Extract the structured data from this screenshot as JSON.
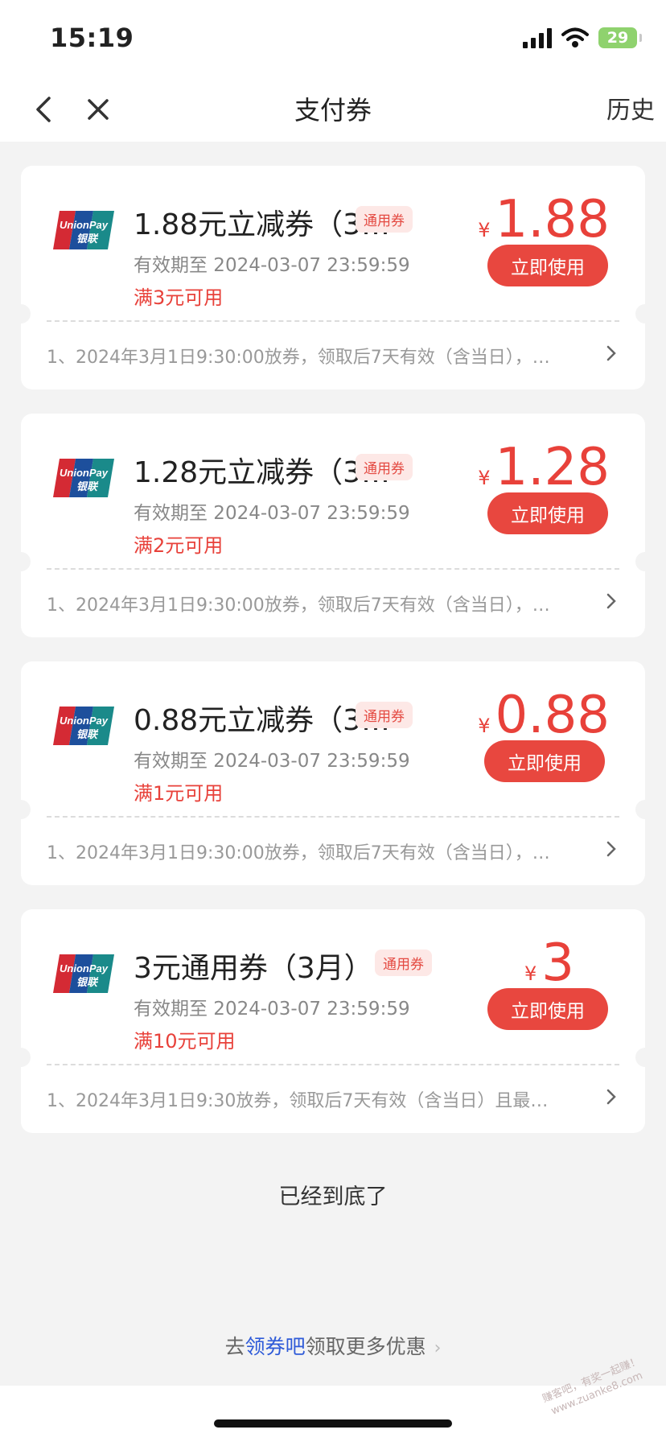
{
  "status_bar": {
    "time": "15:19",
    "battery": "29"
  },
  "header": {
    "title": "支付券",
    "history": "历史"
  },
  "coupons": [
    {
      "title": "1.88元立减券（3…",
      "tag": "通用券",
      "validity": "有效期至 2024-03-07 23:59:59",
      "condition": "满3元可用",
      "currency": "¥",
      "amount": "1.88",
      "button": "立即使用",
      "rule": "1、2024年3月1日9:30:00放券，领取后7天有效（含当日），…"
    },
    {
      "title": "1.28元立减券（3…",
      "tag": "通用券",
      "validity": "有效期至 2024-03-07 23:59:59",
      "condition": "满2元可用",
      "currency": "¥",
      "amount": "1.28",
      "button": "立即使用",
      "rule": "1、2024年3月1日9:30:00放券，领取后7天有效（含当日），…"
    },
    {
      "title": "0.88元立减券（3…",
      "tag": "通用券",
      "validity": "有效期至 2024-03-07 23:59:59",
      "condition": "满1元可用",
      "currency": "¥",
      "amount": "0.88",
      "button": "立即使用",
      "rule": "1、2024年3月1日9:30:00放券，领取后7天有效（含当日），…"
    },
    {
      "title": "3元通用券（3月）",
      "tag": "通用券",
      "validity": "有效期至 2024-03-07 23:59:59",
      "condition": "满10元可用",
      "currency": "¥",
      "amount": "3",
      "button": "立即使用",
      "rule": "1、2024年3月1日9:30放券，领取后7天有效（含当日）且最…"
    }
  ],
  "footer": {
    "end_text": "已经到底了",
    "more_prefix": "去",
    "more_link": "领券吧",
    "more_suffix": "领取更多优惠"
  },
  "watermark": {
    "line1": "赚客吧，有奖一起赚！",
    "line2": "www.zuanke8.com"
  },
  "colors": {
    "accent": "#e8473f",
    "link": "#2f5bd8",
    "background": "#f3f3f3"
  }
}
